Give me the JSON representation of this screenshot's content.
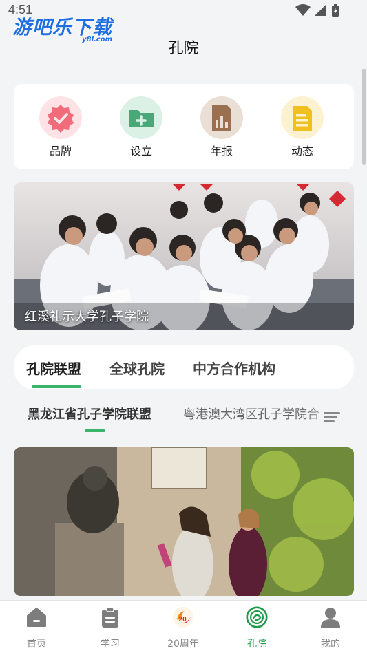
{
  "status_bar": {
    "time": "4:51"
  },
  "watermark": {
    "main": "游吧乐下载",
    "sub": "y8l.com"
  },
  "header": {
    "title": "孔院"
  },
  "quick_links": [
    {
      "label": "品牌",
      "icon": "badge-check-icon",
      "color": "#f26b7a",
      "bg": "#fde3e6"
    },
    {
      "label": "设立",
      "icon": "folder-add-icon",
      "color": "#4aa878",
      "bg": "#dcf1e5"
    },
    {
      "label": "年报",
      "icon": "report-chart-icon",
      "color": "#9a7050",
      "bg": "#eadfd5"
    },
    {
      "label": "动态",
      "icon": "document-lines-icon",
      "color": "#f0c020",
      "bg": "#fcf2cf"
    }
  ],
  "banner": {
    "caption": "红溪礼示大学孔子学院"
  },
  "main_tabs": [
    "孔院联盟",
    "全球孔院",
    "中方合作机构"
  ],
  "sub_tabs": [
    "黑龙江省孔子学院联盟",
    "粤港澳大湾区孔子学院合"
  ],
  "bottom_nav": [
    {
      "label": "首页",
      "icon": "home-icon"
    },
    {
      "label": "学习",
      "icon": "clipboard-icon"
    },
    {
      "label": "20周年",
      "icon": "anniversary-logo-icon"
    },
    {
      "label": "孔院",
      "icon": "institute-logo-icon"
    },
    {
      "label": "我的",
      "icon": "profile-icon"
    }
  ],
  "colors": {
    "accent": "#3bb46a",
    "active_nav": "#1f9a4a"
  }
}
